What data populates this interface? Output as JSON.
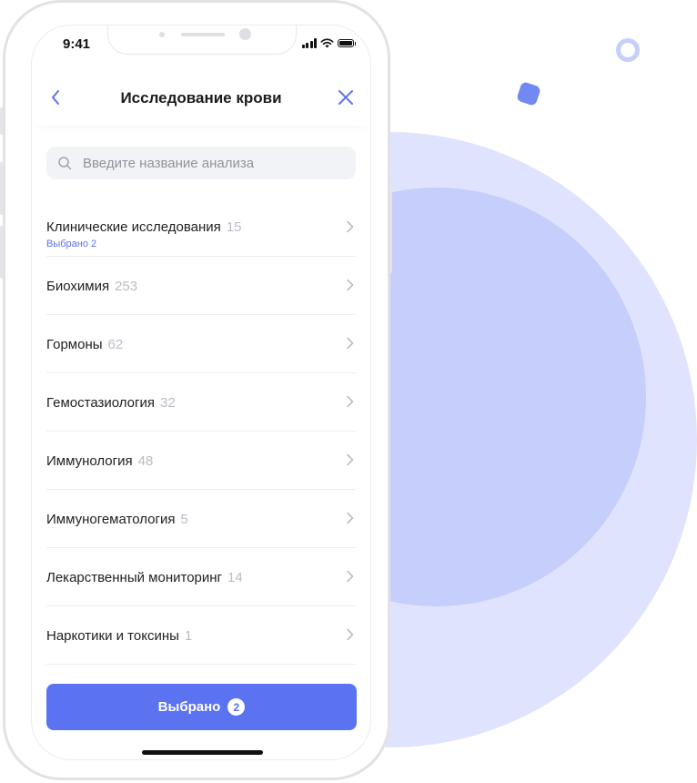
{
  "status_bar": {
    "time": "9:41"
  },
  "navbar": {
    "title": "Исследование крови",
    "back_icon": "chevron-left-icon",
    "close_icon": "close-icon"
  },
  "search": {
    "placeholder": "Введите название анализа",
    "value": ""
  },
  "categories": [
    {
      "label": "Клинические исследования",
      "count": "15",
      "selected_note": "Выбрано 2"
    },
    {
      "label": "Биохимия",
      "count": "253"
    },
    {
      "label": "Гормоны",
      "count": "62"
    },
    {
      "label": "Гемостазиология",
      "count": "32"
    },
    {
      "label": "Иммунология",
      "count": "48"
    },
    {
      "label": "Иммуногематология",
      "count": "5"
    },
    {
      "label": "Лекарственный мониторинг",
      "count": "14"
    },
    {
      "label": "Наркотики и токсины",
      "count": "1"
    }
  ],
  "footer": {
    "button_label": "Выбрано",
    "selected_count": "2"
  },
  "colors": {
    "accent": "#5b73f0",
    "circle_outer": "#dfe3fd",
    "circle_inner": "#c6cefb",
    "muted": "#b9bdc6"
  }
}
